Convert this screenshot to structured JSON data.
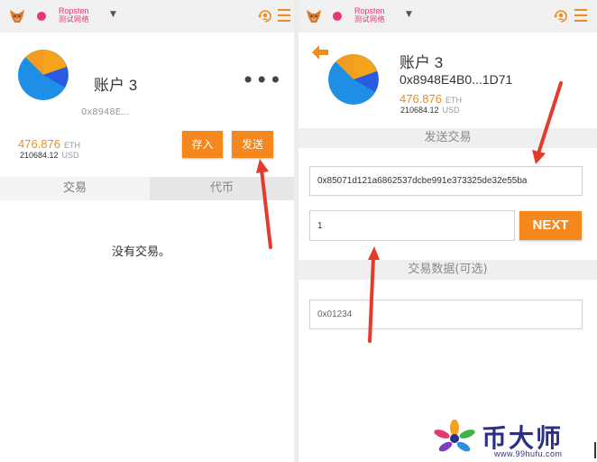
{
  "network": {
    "name_line1": "Ropsten",
    "name_line2": "测试网络",
    "color": "#e73670"
  },
  "account": {
    "name": "账户 3",
    "address_short_left": "0x8948E...",
    "address_short_right": "0x8948E4B0...1D71",
    "balance_eth": "476.876",
    "balance_eth_unit": "ETH",
    "balance_usd": "210684.12",
    "balance_usd_unit": "USD",
    "more_menu": "•••"
  },
  "left": {
    "deposit_label": "存入",
    "send_label": "发送",
    "tabs": [
      {
        "label": "交易",
        "active": true
      },
      {
        "label": "代币",
        "active": false
      }
    ],
    "empty_message": "没有交易。"
  },
  "right": {
    "send_section_title": "发送交易",
    "recipient_value": "0x85071d121a6862537dcbe991e373325de32e55ba",
    "amount_value": "1",
    "next_label": "NEXT",
    "data_section_title": "交易数据(可选)",
    "data_value": "0x01234"
  },
  "watermark": {
    "brand": "币大师",
    "url": "www.99hufu.com"
  },
  "colors": {
    "accent": "#f5871f",
    "arrow": "#e53b2c",
    "brand": "#2c2f86"
  },
  "icons": [
    "metamask-fox-icon",
    "network-dot-icon",
    "dropdown-caret-icon",
    "account-switch-icon",
    "hamburger-menu-icon",
    "back-arrow-icon",
    "more-options-icon"
  ]
}
